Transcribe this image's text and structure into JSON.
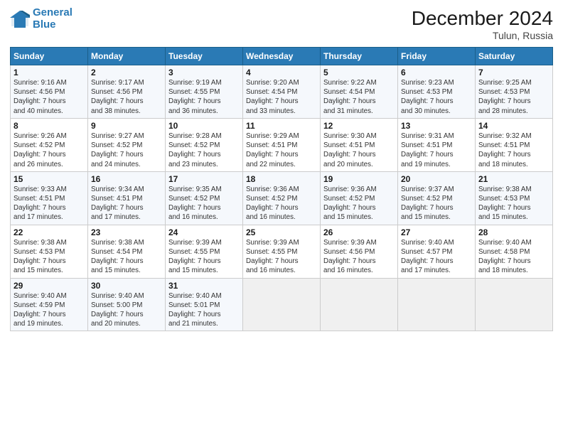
{
  "logo": {
    "line1": "General",
    "line2": "Blue"
  },
  "title": "December 2024",
  "subtitle": "Tulun, Russia",
  "headers": [
    "Sunday",
    "Monday",
    "Tuesday",
    "Wednesday",
    "Thursday",
    "Friday",
    "Saturday"
  ],
  "weeks": [
    [
      {
        "day": "1",
        "info": "Sunrise: 9:16 AM\nSunset: 4:56 PM\nDaylight: 7 hours\nand 40 minutes."
      },
      {
        "day": "2",
        "info": "Sunrise: 9:17 AM\nSunset: 4:56 PM\nDaylight: 7 hours\nand 38 minutes."
      },
      {
        "day": "3",
        "info": "Sunrise: 9:19 AM\nSunset: 4:55 PM\nDaylight: 7 hours\nand 36 minutes."
      },
      {
        "day": "4",
        "info": "Sunrise: 9:20 AM\nSunset: 4:54 PM\nDaylight: 7 hours\nand 33 minutes."
      },
      {
        "day": "5",
        "info": "Sunrise: 9:22 AM\nSunset: 4:54 PM\nDaylight: 7 hours\nand 31 minutes."
      },
      {
        "day": "6",
        "info": "Sunrise: 9:23 AM\nSunset: 4:53 PM\nDaylight: 7 hours\nand 30 minutes."
      },
      {
        "day": "7",
        "info": "Sunrise: 9:25 AM\nSunset: 4:53 PM\nDaylight: 7 hours\nand 28 minutes."
      }
    ],
    [
      {
        "day": "8",
        "info": "Sunrise: 9:26 AM\nSunset: 4:52 PM\nDaylight: 7 hours\nand 26 minutes."
      },
      {
        "day": "9",
        "info": "Sunrise: 9:27 AM\nSunset: 4:52 PM\nDaylight: 7 hours\nand 24 minutes."
      },
      {
        "day": "10",
        "info": "Sunrise: 9:28 AM\nSunset: 4:52 PM\nDaylight: 7 hours\nand 23 minutes."
      },
      {
        "day": "11",
        "info": "Sunrise: 9:29 AM\nSunset: 4:51 PM\nDaylight: 7 hours\nand 22 minutes."
      },
      {
        "day": "12",
        "info": "Sunrise: 9:30 AM\nSunset: 4:51 PM\nDaylight: 7 hours\nand 20 minutes."
      },
      {
        "day": "13",
        "info": "Sunrise: 9:31 AM\nSunset: 4:51 PM\nDaylight: 7 hours\nand 19 minutes."
      },
      {
        "day": "14",
        "info": "Sunrise: 9:32 AM\nSunset: 4:51 PM\nDaylight: 7 hours\nand 18 minutes."
      }
    ],
    [
      {
        "day": "15",
        "info": "Sunrise: 9:33 AM\nSunset: 4:51 PM\nDaylight: 7 hours\nand 17 minutes."
      },
      {
        "day": "16",
        "info": "Sunrise: 9:34 AM\nSunset: 4:51 PM\nDaylight: 7 hours\nand 17 minutes."
      },
      {
        "day": "17",
        "info": "Sunrise: 9:35 AM\nSunset: 4:52 PM\nDaylight: 7 hours\nand 16 minutes."
      },
      {
        "day": "18",
        "info": "Sunrise: 9:36 AM\nSunset: 4:52 PM\nDaylight: 7 hours\nand 16 minutes."
      },
      {
        "day": "19",
        "info": "Sunrise: 9:36 AM\nSunset: 4:52 PM\nDaylight: 7 hours\nand 15 minutes."
      },
      {
        "day": "20",
        "info": "Sunrise: 9:37 AM\nSunset: 4:52 PM\nDaylight: 7 hours\nand 15 minutes."
      },
      {
        "day": "21",
        "info": "Sunrise: 9:38 AM\nSunset: 4:53 PM\nDaylight: 7 hours\nand 15 minutes."
      }
    ],
    [
      {
        "day": "22",
        "info": "Sunrise: 9:38 AM\nSunset: 4:53 PM\nDaylight: 7 hours\nand 15 minutes."
      },
      {
        "day": "23",
        "info": "Sunrise: 9:38 AM\nSunset: 4:54 PM\nDaylight: 7 hours\nand 15 minutes."
      },
      {
        "day": "24",
        "info": "Sunrise: 9:39 AM\nSunset: 4:55 PM\nDaylight: 7 hours\nand 15 minutes."
      },
      {
        "day": "25",
        "info": "Sunrise: 9:39 AM\nSunset: 4:55 PM\nDaylight: 7 hours\nand 16 minutes."
      },
      {
        "day": "26",
        "info": "Sunrise: 9:39 AM\nSunset: 4:56 PM\nDaylight: 7 hours\nand 16 minutes."
      },
      {
        "day": "27",
        "info": "Sunrise: 9:40 AM\nSunset: 4:57 PM\nDaylight: 7 hours\nand 17 minutes."
      },
      {
        "day": "28",
        "info": "Sunrise: 9:40 AM\nSunset: 4:58 PM\nDaylight: 7 hours\nand 18 minutes."
      }
    ],
    [
      {
        "day": "29",
        "info": "Sunrise: 9:40 AM\nSunset: 4:59 PM\nDaylight: 7 hours\nand 19 minutes."
      },
      {
        "day": "30",
        "info": "Sunrise: 9:40 AM\nSunset: 5:00 PM\nDaylight: 7 hours\nand 20 minutes."
      },
      {
        "day": "31",
        "info": "Sunrise: 9:40 AM\nSunset: 5:01 PM\nDaylight: 7 hours\nand 21 minutes."
      },
      {
        "day": "",
        "info": ""
      },
      {
        "day": "",
        "info": ""
      },
      {
        "day": "",
        "info": ""
      },
      {
        "day": "",
        "info": ""
      }
    ]
  ]
}
